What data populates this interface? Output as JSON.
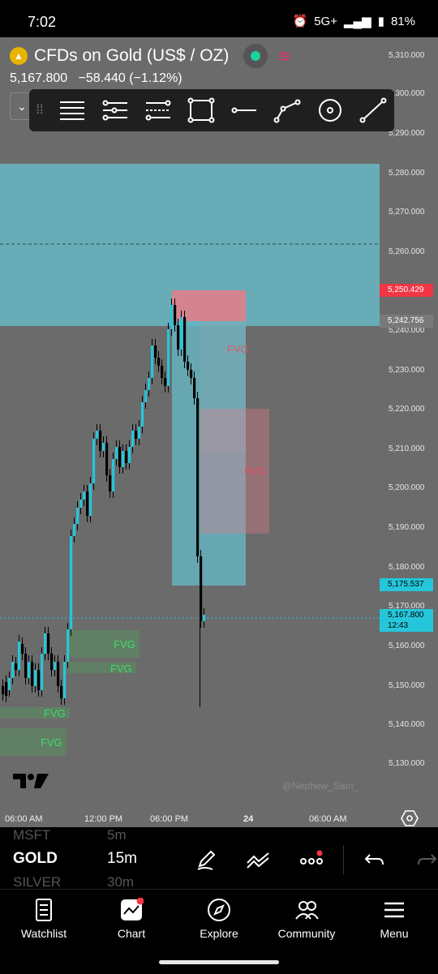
{
  "status_bar": {
    "time": "7:02",
    "network": "5G+",
    "battery": "81%"
  },
  "instrument": {
    "title": "CFDs on Gold (US$ / OZ)",
    "last": "5,167.800",
    "change": "−58.440 (−1.12%)"
  },
  "drawing_toolbar": {
    "tools": [
      "horizontal-lines-icon",
      "parallel-lines-icon",
      "fib-lines-icon",
      "rectangle-icon",
      "horizontal-ray-icon",
      "path-icon",
      "circle-icon",
      "trend-line-icon"
    ]
  },
  "price_axis": {
    "ticks": [
      "5,310.000",
      "5,300.000",
      "5,290.000",
      "5,280.000",
      "5,270.000",
      "5,260.000",
      "5,250.000",
      "5,240.000",
      "5,230.000",
      "5,220.000",
      "5,210.000",
      "5,200.000",
      "5,190.000",
      "5,180.000",
      "5,170.000",
      "5,160.000",
      "5,150.000",
      "5,140.000",
      "5,130.000"
    ],
    "labels": [
      {
        "text": "5,250.429",
        "color": "#f23645"
      },
      {
        "text": "5,242.756",
        "color": "#7a7a7a"
      },
      {
        "text": "5,175.537",
        "color": "#26c6da"
      },
      {
        "text": "5,167.800",
        "sub": "12:43",
        "color": "#26c6da"
      }
    ]
  },
  "chart_data": {
    "type": "candlestick",
    "fvg_labels": [
      "FVG",
      "FVG",
      "FVG",
      "FVG",
      "FVG",
      "FVG"
    ],
    "colors": {
      "up": "#26c6da",
      "down": "#000000",
      "zone": "#66b7c4",
      "bear_zone": "#e67c87",
      "fvg_bull": "#4caf50"
    }
  },
  "time_axis": {
    "labels": [
      "06:00 AM",
      "12:00 PM",
      "06:00 PM",
      "24",
      "06:00 AM"
    ]
  },
  "branding": {
    "watermark": "@Nephew_Sam_"
  },
  "symbol_bar": {
    "prev_symbol": "MSFT",
    "prev_tf": "5m",
    "symbol": "GOLD",
    "timeframe": "15m",
    "next_symbol": "SILVER",
    "next_tf": "30m"
  },
  "bottom_nav": {
    "items": [
      "Watchlist",
      "Chart",
      "Explore",
      "Community",
      "Menu"
    ]
  }
}
